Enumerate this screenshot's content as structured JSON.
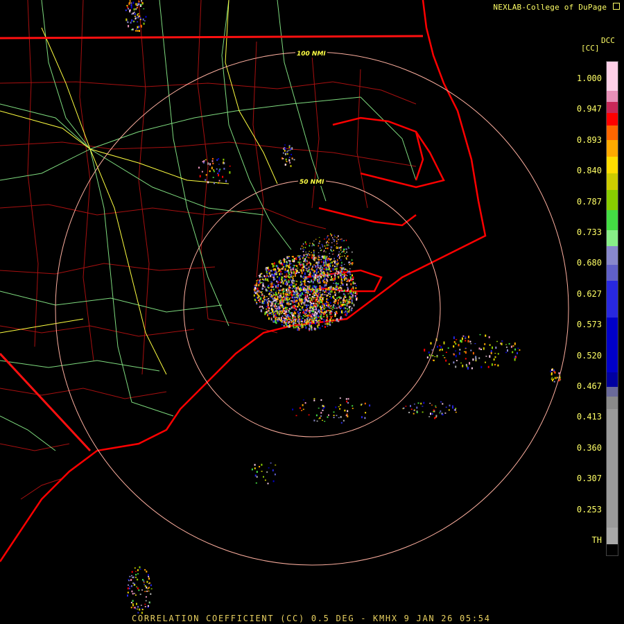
{
  "credit": "NEXLAB-College of DuPage",
  "footer": "CORRELATION COEFFICIENT (CC) 0.5 DEG - KMHX 9 JAN 26 05:54",
  "product_code": "DCC",
  "legend": {
    "unit": "[CC]",
    "labels": [
      "1.000",
      "0.947",
      "0.893",
      "0.840",
      "0.787",
      "0.733",
      "0.680",
      "0.627",
      "0.573",
      "0.520",
      "0.467",
      "0.413",
      "0.360",
      "0.307",
      "0.253",
      "TH"
    ],
    "colors": [
      "#ffd0e8",
      "#e890b8",
      "#c82858",
      "#ff0000",
      "#ff6600",
      "#ffaa00",
      "#ffdd00",
      "#cccc00",
      "#88cc00",
      "#44dd44",
      "#88ee88",
      "#8888cc",
      "#6060c8",
      "#2828e0",
      "#0000c8",
      "#0000a0",
      "#6a6a9a",
      "#8a8a8a",
      "#9a9a9a",
      "#a8a8a8",
      "#000000"
    ]
  },
  "rings": [
    {
      "label": "100 NMI"
    },
    {
      "label": "50 NMI"
    }
  ],
  "colors": {
    "background": "#000000",
    "state_border": "#ff0000",
    "county": "#b01010",
    "highway": "#88ee88",
    "interstate": "#ffff44",
    "ring": "#ffb0a0"
  }
}
